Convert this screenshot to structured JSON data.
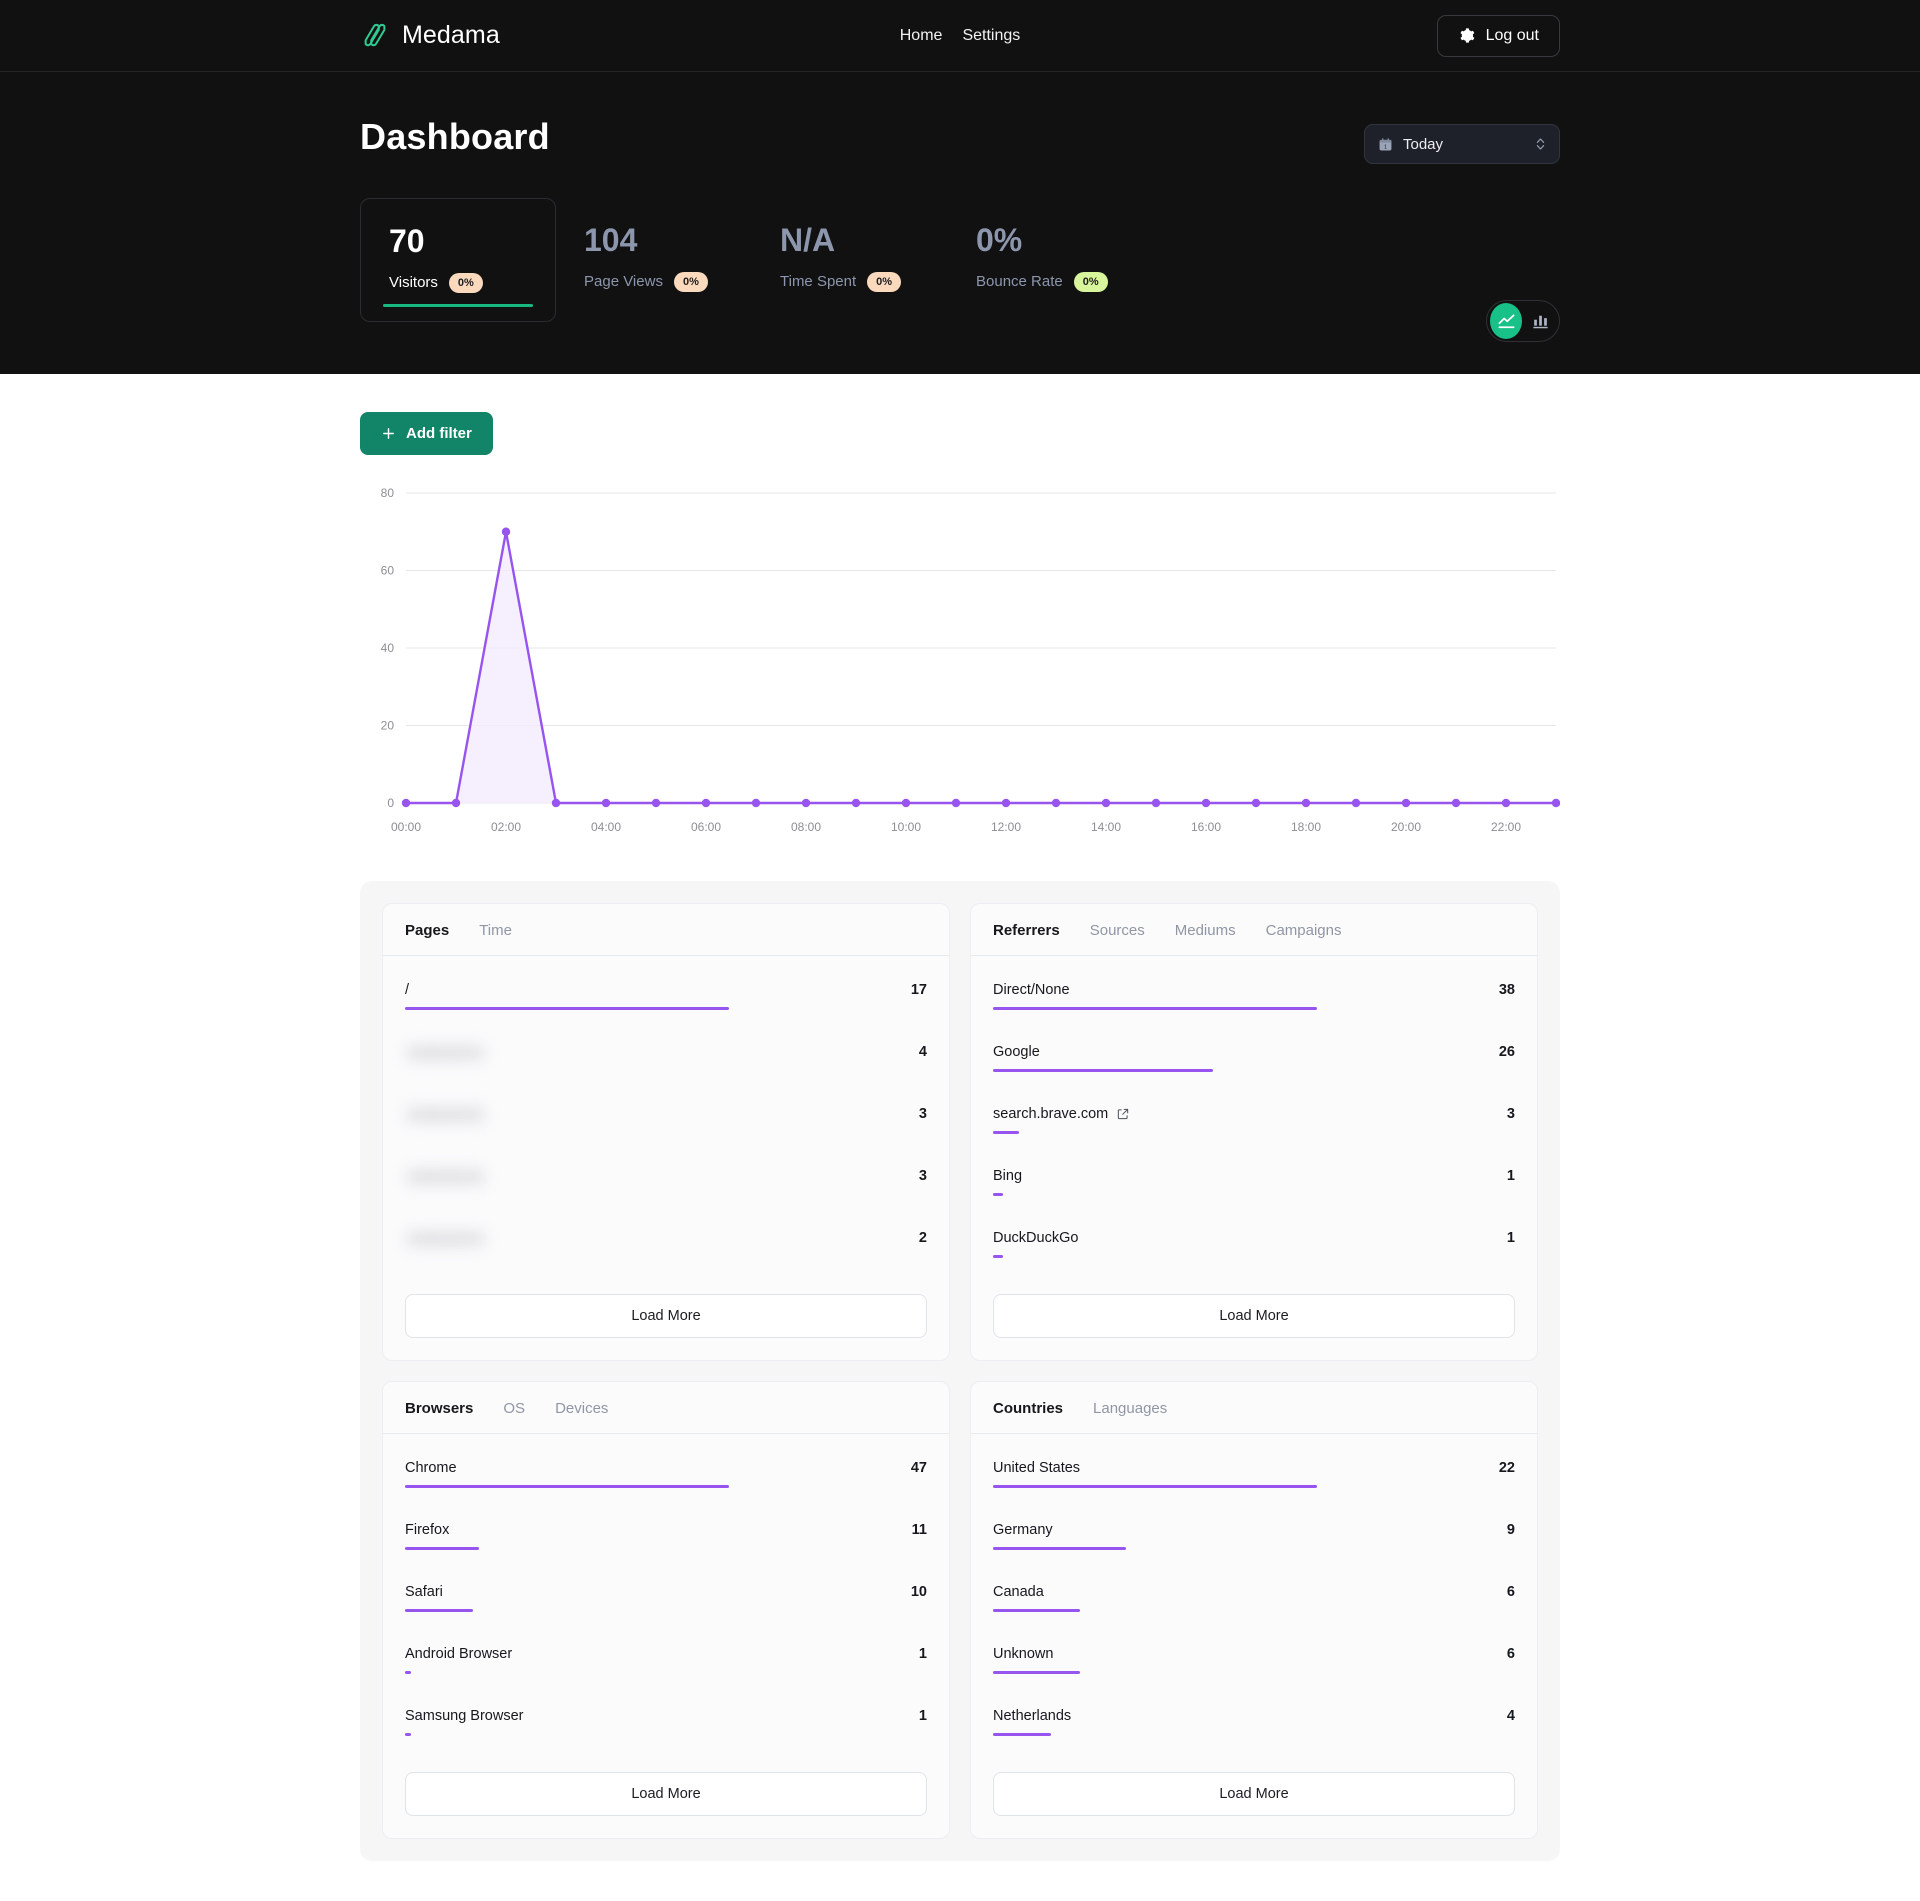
{
  "header": {
    "brand": "Medama",
    "nav": [
      {
        "label": "Home"
      },
      {
        "label": "Settings"
      }
    ],
    "logout_label": "Log out",
    "logout_icon": "gear-icon"
  },
  "hero": {
    "title": "Dashboard",
    "period": {
      "label": "Today",
      "icon": "calendar-icon",
      "chevron": "chevron-updown-icon"
    },
    "stats": [
      {
        "value": "70",
        "label": "Visitors",
        "badge": "0%",
        "badge_color": "#fbd9bc",
        "active": true
      },
      {
        "value": "104",
        "label": "Page Views",
        "badge": "0%",
        "badge_color": "#fbd9bc",
        "active": false
      },
      {
        "value": "N/A",
        "label": "Time Spent",
        "badge": "0%",
        "badge_color": "#fbd9bc",
        "active": false
      },
      {
        "value": "0%",
        "label": "Bounce Rate",
        "badge": "0%",
        "badge_color": "#d9f59c",
        "active": false
      }
    ],
    "chart_toggle": [
      {
        "icon": "line-chart-icon",
        "active": true
      },
      {
        "icon": "bar-chart-icon",
        "active": false
      }
    ],
    "accent_green": "#17b981"
  },
  "filters": {
    "add_filter_label": "Add filter",
    "add_filter_icon": "plus-icon"
  },
  "chart_data": {
    "type": "area",
    "title": "",
    "xlabel": "",
    "ylabel": "",
    "ylim": [
      0,
      80
    ],
    "yticks": [
      0,
      20,
      40,
      60,
      80
    ],
    "grid": true,
    "legend": false,
    "line_color": "#9754ee",
    "fill_color": "#f3ebfd",
    "x": [
      "00:00",
      "01:00",
      "02:00",
      "03:00",
      "04:00",
      "05:00",
      "06:00",
      "07:00",
      "08:00",
      "09:00",
      "10:00",
      "11:00",
      "12:00",
      "13:00",
      "14:00",
      "15:00",
      "16:00",
      "17:00",
      "18:00",
      "19:00",
      "20:00",
      "21:00",
      "22:00",
      "23:00"
    ],
    "xtick_labels": [
      "00:00",
      "02:00",
      "04:00",
      "06:00",
      "08:00",
      "10:00",
      "12:00",
      "14:00",
      "16:00",
      "18:00",
      "20:00",
      "22:00"
    ],
    "series": [
      {
        "name": "Visitors",
        "values": [
          0,
          0,
          70,
          0,
          0,
          0,
          0,
          0,
          0,
          0,
          0,
          0,
          0,
          0,
          0,
          0,
          0,
          0,
          0,
          0,
          0,
          0,
          0,
          0
        ]
      }
    ]
  },
  "panels": [
    {
      "name": "pages",
      "tabs": [
        {
          "label": "Pages",
          "active": true
        },
        {
          "label": "Time",
          "active": false
        }
      ],
      "rows": [
        {
          "name": "/",
          "value": "17",
          "pct": 100,
          "blurred": false,
          "external": false
        },
        {
          "name": "redacted-1",
          "value": "4",
          "pct": 24,
          "blurred": true,
          "external": false
        },
        {
          "name": "redacted-2",
          "value": "3",
          "pct": 18,
          "blurred": true,
          "external": false
        },
        {
          "name": "redacted-3",
          "value": "3",
          "pct": 18,
          "blurred": true,
          "external": false
        },
        {
          "name": "redacted-4",
          "value": "2",
          "pct": 12,
          "blurred": true,
          "external": false
        }
      ],
      "load_more_label": "Load More"
    },
    {
      "name": "referrers",
      "tabs": [
        {
          "label": "Referrers",
          "active": true
        },
        {
          "label": "Sources",
          "active": false
        },
        {
          "label": "Mediums",
          "active": false
        },
        {
          "label": "Campaigns",
          "active": false
        }
      ],
      "rows": [
        {
          "name": "Direct/None",
          "value": "38",
          "pct": 100,
          "blurred": false,
          "external": false
        },
        {
          "name": "Google",
          "value": "26",
          "pct": 68,
          "blurred": false,
          "external": false
        },
        {
          "name": "search.brave.com",
          "value": "3",
          "pct": 8,
          "blurred": false,
          "external": true
        },
        {
          "name": "Bing",
          "value": "1",
          "pct": 3,
          "blurred": false,
          "external": false
        },
        {
          "name": "DuckDuckGo",
          "value": "1",
          "pct": 3,
          "blurred": false,
          "external": false
        }
      ],
      "load_more_label": "Load More"
    },
    {
      "name": "browsers",
      "tabs": [
        {
          "label": "Browsers",
          "active": true
        },
        {
          "label": "OS",
          "active": false
        },
        {
          "label": "Devices",
          "active": false
        }
      ],
      "rows": [
        {
          "name": "Chrome",
          "value": "47",
          "pct": 100,
          "blurred": false,
          "external": false
        },
        {
          "name": "Firefox",
          "value": "11",
          "pct": 23,
          "blurred": false,
          "external": false
        },
        {
          "name": "Safari",
          "value": "10",
          "pct": 21,
          "blurred": false,
          "external": false
        },
        {
          "name": "Android Browser",
          "value": "1",
          "pct": 2,
          "blurred": false,
          "external": false
        },
        {
          "name": "Samsung Browser",
          "value": "1",
          "pct": 2,
          "blurred": false,
          "external": false
        }
      ],
      "load_more_label": "Load More"
    },
    {
      "name": "countries",
      "tabs": [
        {
          "label": "Countries",
          "active": true
        },
        {
          "label": "Languages",
          "active": false
        }
      ],
      "rows": [
        {
          "name": "United States",
          "value": "22",
          "pct": 100,
          "blurred": false,
          "external": false
        },
        {
          "name": "Germany",
          "value": "9",
          "pct": 41,
          "blurred": false,
          "external": false
        },
        {
          "name": "Canada",
          "value": "6",
          "pct": 27,
          "blurred": false,
          "external": false
        },
        {
          "name": "Unknown",
          "value": "6",
          "pct": 27,
          "blurred": false,
          "external": false
        },
        {
          "name": "Netherlands",
          "value": "4",
          "pct": 18,
          "blurred": false,
          "external": false
        }
      ],
      "load_more_label": "Load More"
    }
  ]
}
